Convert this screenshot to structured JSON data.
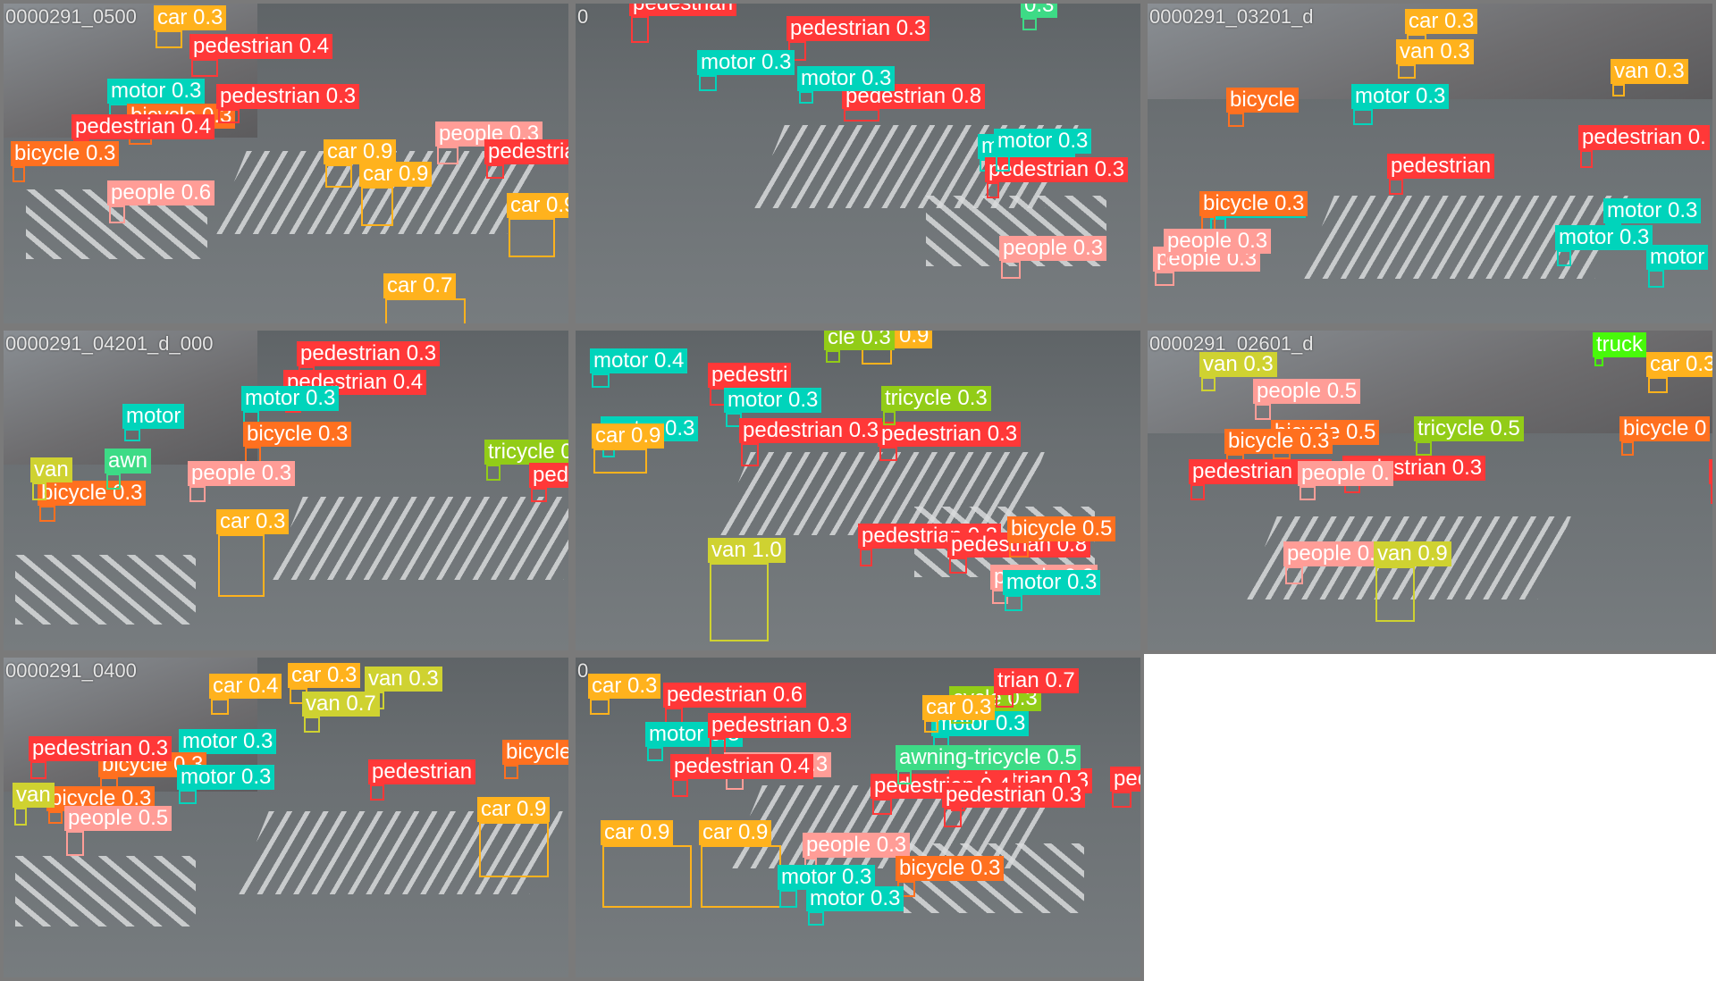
{
  "classes": {
    "pedestrian": "#ff3838",
    "people": "#ff9d97",
    "bicycle": "#ff701f",
    "car": "#ffb21d",
    "van": "#cfd231",
    "truck": "#48f90a",
    "tricycle": "#92cc17",
    "awning-tricycle": "#3ddb86",
    "bus": "#1a9334",
    "motor": "#00d4bb"
  },
  "tiles": [
    {
      "caption": "0000291_0500",
      "detections": [
        {
          "label": "car 0.3",
          "cls": "car"
        },
        {
          "label": "pedestrian 0.4",
          "cls": "pedestrian"
        },
        {
          "label": "motor 0.3",
          "cls": "motor"
        },
        {
          "label": "bicycle 0.3",
          "cls": "bicycle"
        },
        {
          "label": "pedestrian 0.4",
          "cls": "pedestrian"
        },
        {
          "label": "car 0.9",
          "cls": "car"
        },
        {
          "label": "car 0.9",
          "cls": "car"
        },
        {
          "label": "people 0.3",
          "cls": "people"
        },
        {
          "label": "pedestrian 0.4",
          "cls": "pedestrian"
        },
        {
          "label": "people 0.6",
          "cls": "people"
        },
        {
          "label": "car 0.9",
          "cls": "car"
        },
        {
          "label": "car 0.7",
          "cls": "car"
        },
        {
          "label": "pedestrian 0.3",
          "cls": "pedestrian"
        },
        {
          "label": "bicycle 0.3",
          "cls": "bicycle"
        }
      ]
    },
    {
      "caption": "0",
      "detections": [
        {
          "label": "pedestrian",
          "cls": "pedestrian"
        },
        {
          "label": "pedestrian 0.3",
          "cls": "pedestrian"
        },
        {
          "label": "motor 0.3",
          "cls": "motor"
        },
        {
          "label": "pedestrian 0.8",
          "cls": "pedestrian"
        },
        {
          "label": "motor 0.3",
          "cls": "motor"
        },
        {
          "label": "motor 0.3",
          "cls": "motor"
        },
        {
          "label": "pedestrian 0.3",
          "cls": "pedestrian"
        },
        {
          "label": "motor 0.3",
          "cls": "motor"
        },
        {
          "label": "people 0.3",
          "cls": "people"
        },
        {
          "label": "0.3",
          "cls": "awning-tricycle"
        }
      ]
    },
    {
      "caption": "0000291_03201_d",
      "detections": [
        {
          "label": "car 0.3",
          "cls": "car"
        },
        {
          "label": "van 0.3",
          "cls": "car"
        },
        {
          "label": "bicycle",
          "cls": "bicycle"
        },
        {
          "label": "motor 0.3",
          "cls": "motor"
        },
        {
          "label": "pedestrian",
          "cls": "pedestrian"
        },
        {
          "label": "pedestrian 0.",
          "cls": "pedestrian"
        },
        {
          "label": "motor 0.3",
          "cls": "motor"
        },
        {
          "label": "motor 0.3",
          "cls": "motor"
        },
        {
          "label": "people 0.3",
          "cls": "people"
        },
        {
          "label": "van 0.3",
          "cls": "car"
        },
        {
          "label": "bicycle 0.3",
          "cls": "bicycle"
        },
        {
          "label": "motor 0.3",
          "cls": "motor"
        },
        {
          "label": "motor",
          "cls": "motor"
        },
        {
          "label": "people 0.3",
          "cls": "people"
        }
      ]
    },
    {
      "caption": "0000291_04201_d_000",
      "detections": [
        {
          "label": "pedestrian 0.3",
          "cls": "pedestrian"
        },
        {
          "label": "pedestrian 0.4",
          "cls": "pedestrian"
        },
        {
          "label": "motor 0.3",
          "cls": "motor"
        },
        {
          "label": "motor",
          "cls": "motor"
        },
        {
          "label": "bicycle 0.3",
          "cls": "bicycle"
        },
        {
          "label": "people 0.3",
          "cls": "people"
        },
        {
          "label": "tricycle 0.4",
          "cls": "tricycle"
        },
        {
          "label": "pedestrian 0.3",
          "cls": "pedestrian"
        },
        {
          "label": "bicycle 0.3",
          "cls": "bicycle"
        },
        {
          "label": "van",
          "cls": "van"
        },
        {
          "label": "awn",
          "cls": "awning-tricycle"
        },
        {
          "label": "car 0.3",
          "cls": "car"
        }
      ]
    },
    {
      "caption": "",
      "detections": [
        {
          "label": "motor 0.4",
          "cls": "motor"
        },
        {
          "label": "pedestri",
          "cls": "pedestrian"
        },
        {
          "label": "motor 0.3",
          "cls": "motor"
        },
        {
          "label": "pedestrian 0.3",
          "cls": "pedestrian"
        },
        {
          "label": "motor 0.3",
          "cls": "motor"
        },
        {
          "label": "car 0.9",
          "cls": "car"
        },
        {
          "label": "pedestrian 0.3",
          "cls": "pedestrian"
        },
        {
          "label": "van 1.0",
          "cls": "van"
        },
        {
          "label": "tricycle 0.3",
          "cls": "tricycle"
        },
        {
          "label": "pedestrian 0.3",
          "cls": "pedestrian"
        },
        {
          "label": "pedestrian 0.8",
          "cls": "pedestrian"
        },
        {
          "label": "people 0.3",
          "cls": "people"
        },
        {
          "label": "bicycle 0.5",
          "cls": "bicycle"
        },
        {
          "label": "motor 0.3",
          "cls": "motor"
        },
        {
          "label": "car 0.9",
          "cls": "car"
        },
        {
          "label": "cle 0.3",
          "cls": "tricycle"
        }
      ]
    },
    {
      "caption": "0000291_02601_d",
      "detections": [
        {
          "label": "van 0.3",
          "cls": "van"
        },
        {
          "label": "people 0.5",
          "cls": "people"
        },
        {
          "label": "bicycle 0.5",
          "cls": "bicycle"
        },
        {
          "label": "bicycle 0.3",
          "cls": "bicycle"
        },
        {
          "label": "tricycle 0.5",
          "cls": "tricycle"
        },
        {
          "label": "pedestrian 0.3",
          "cls": "pedestrian"
        },
        {
          "label": "pedestrian 0.3",
          "cls": "pedestrian"
        },
        {
          "label": "pedestrian",
          "cls": "pedestrian"
        },
        {
          "label": "people 0.5",
          "cls": "people"
        },
        {
          "label": "van 0.9",
          "cls": "van"
        },
        {
          "label": "people 0.",
          "cls": "people"
        },
        {
          "label": "truck",
          "cls": "truck"
        },
        {
          "label": "car 0.3",
          "cls": "car"
        },
        {
          "label": "bicycle 0",
          "cls": "bicycle"
        }
      ]
    },
    {
      "caption": "0000291_0400",
      "detections": [
        {
          "label": "car 0.4",
          "cls": "car"
        },
        {
          "label": "car 0.3",
          "cls": "car"
        },
        {
          "label": "van 0.3",
          "cls": "van"
        },
        {
          "label": "van 0.7",
          "cls": "van"
        },
        {
          "label": "motor 0.3",
          "cls": "motor"
        },
        {
          "label": "bicycle 0.3",
          "cls": "bicycle"
        },
        {
          "label": "pedestrian 0.3",
          "cls": "pedestrian"
        },
        {
          "label": "motor 0.3",
          "cls": "motor"
        },
        {
          "label": "bicycle 0.3",
          "cls": "bicycle"
        },
        {
          "label": "pedestrian",
          "cls": "pedestrian"
        },
        {
          "label": "van",
          "cls": "van"
        },
        {
          "label": "car 0.9",
          "cls": "car"
        },
        {
          "label": "people 0.5",
          "cls": "people"
        },
        {
          "label": "bicycle 0.6",
          "cls": "bicycle"
        }
      ]
    },
    {
      "caption": "0",
      "detections": [
        {
          "label": "car 0.3",
          "cls": "car"
        },
        {
          "label": "pedestrian 0.6",
          "cls": "pedestrian"
        },
        {
          "label": "motor 0.3",
          "cls": "motor"
        },
        {
          "label": "pedestrian 0.3",
          "cls": "pedestrian"
        },
        {
          "label": "people 0.3",
          "cls": "people"
        },
        {
          "label": "motor 0.3",
          "cls": "motor"
        },
        {
          "label": "pedestrian 0.3",
          "cls": "pedestrian"
        },
        {
          "label": "people 0.3",
          "cls": "people"
        },
        {
          "label": "pedestrian 0.4",
          "cls": "pedestrian"
        },
        {
          "label": "pedestrian 0.4",
          "cls": "pedestrian"
        },
        {
          "label": "awning-tricycle 0.5",
          "cls": "awning-tricycle"
        },
        {
          "label": "pedestrian 0.3",
          "cls": "pedestrian"
        },
        {
          "label": "bicycle 0.3",
          "cls": "bicycle"
        },
        {
          "label": "car 0.9",
          "cls": "car"
        },
        {
          "label": "car 0.9",
          "cls": "car"
        },
        {
          "label": "motor 0.3",
          "cls": "motor"
        },
        {
          "label": "motor 0.3",
          "cls": "motor"
        },
        {
          "label": "pedestrian 0.4",
          "cls": "pedestrian"
        },
        {
          "label": "cycle 0.3",
          "cls": "tricycle"
        },
        {
          "label": "trian 0.7",
          "cls": "pedestrian"
        },
        {
          "label": "car 0.3",
          "cls": "car"
        }
      ]
    }
  ]
}
